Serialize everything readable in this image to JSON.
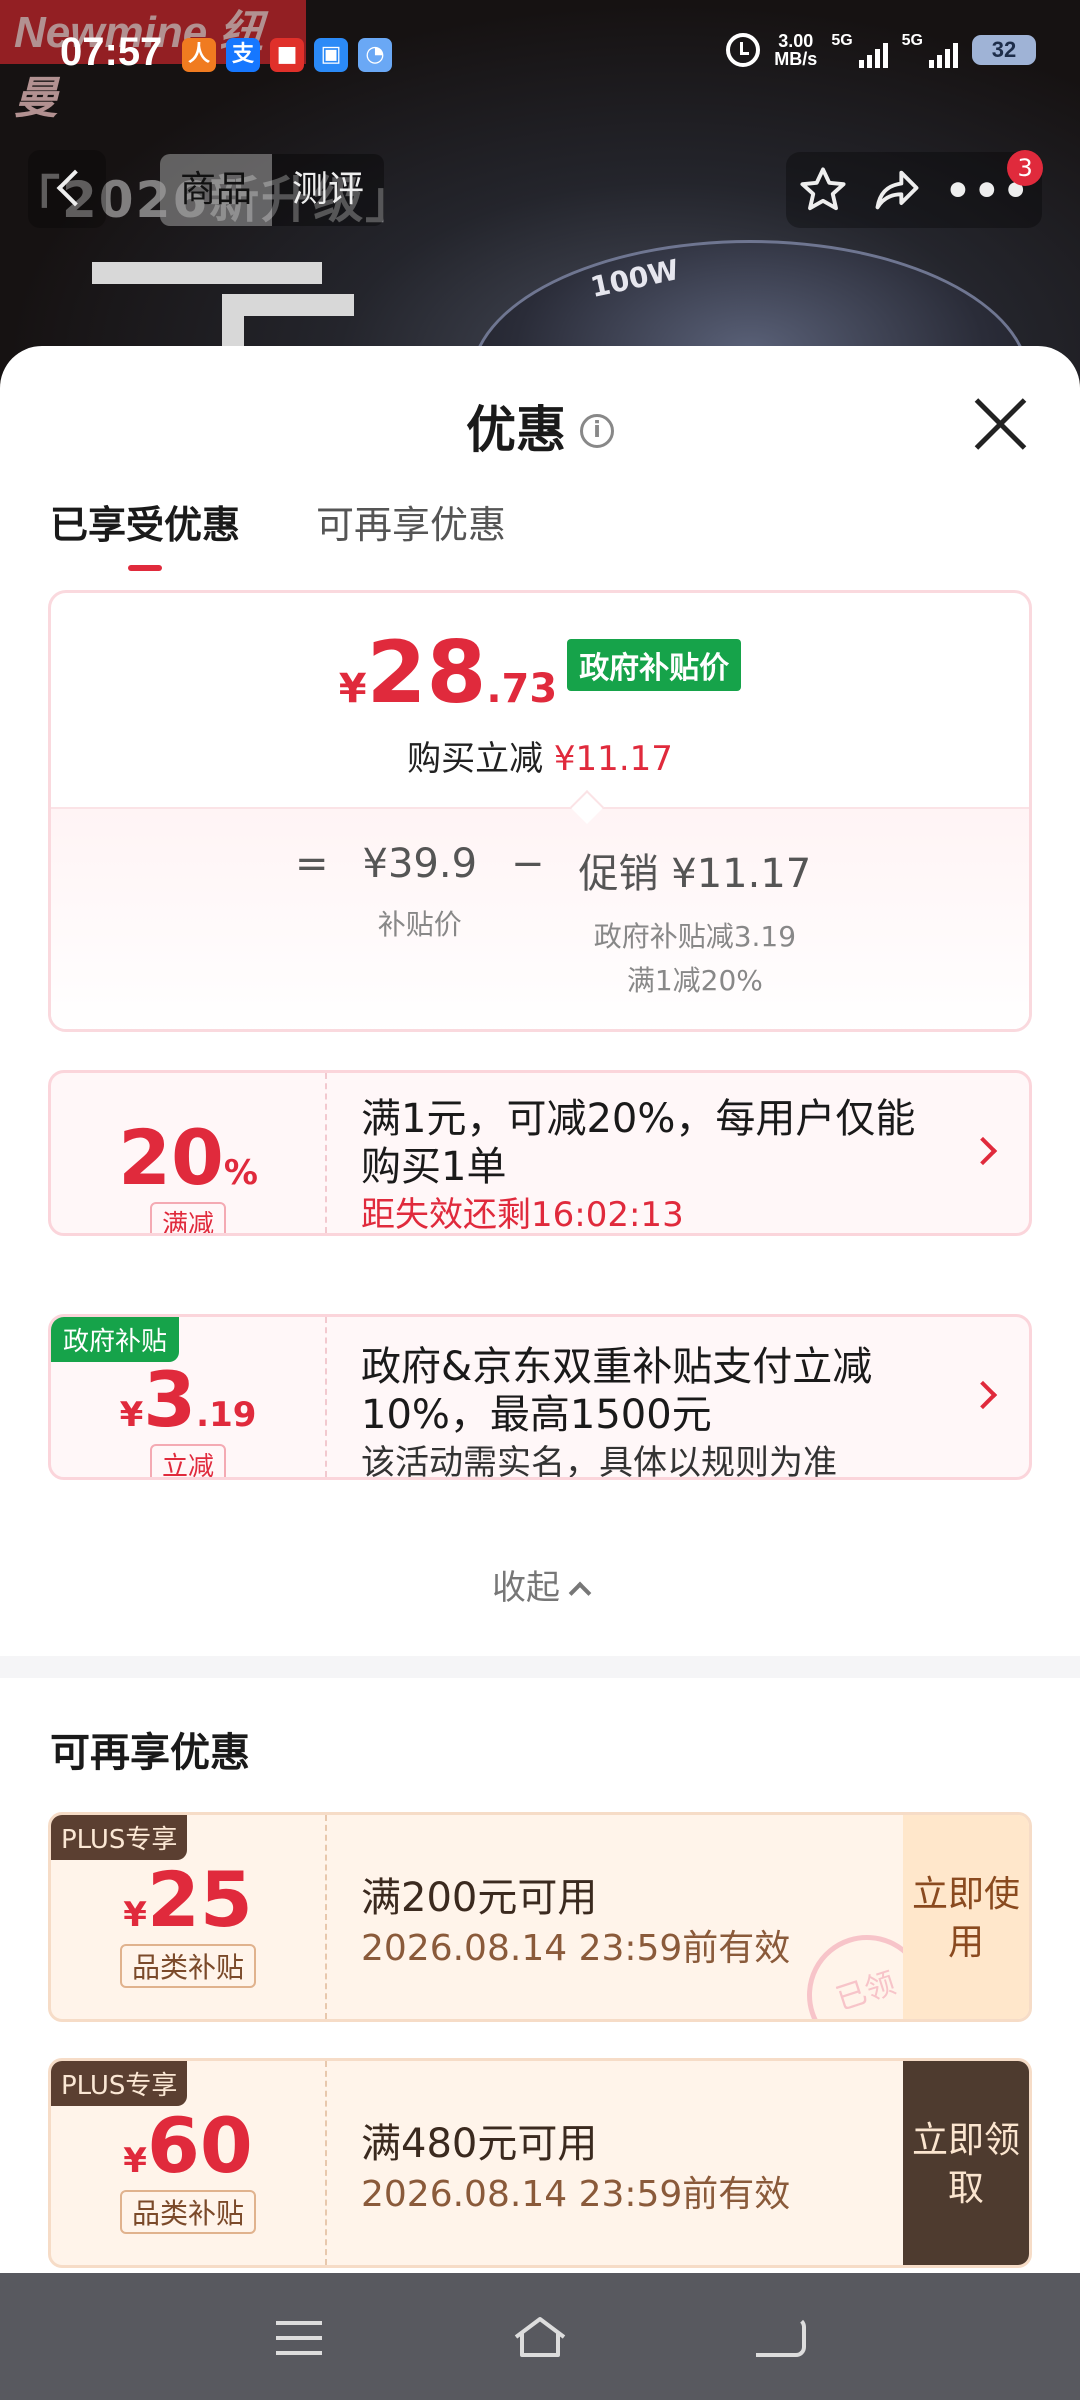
{
  "status_bar": {
    "time": "07:57",
    "speed_value": "3.00",
    "speed_unit": "MB/s",
    "net1": "5G",
    "net2": "5G",
    "battery": "32"
  },
  "backdrop": {
    "brand": "Newmine 纽曼",
    "banner_text": "「2026新升级」",
    "disc_label": "100W"
  },
  "nav": {
    "tabs": [
      "商品",
      "测评"
    ],
    "cart_badge": "3"
  },
  "sheet": {
    "title": "优惠",
    "tabs": [
      "已享受优惠",
      "可再享优惠"
    ]
  },
  "summary": {
    "currency": "¥",
    "price_int": "28",
    "price_dec": ".73",
    "gov_tag": "政府补贴价",
    "instant_label": "购买立减",
    "instant_amount": "¥11.17",
    "equals": "=",
    "base_price": "¥39.9",
    "base_label": "补贴价",
    "minus": "−",
    "promo_price": "促销 ¥11.17",
    "promo_sub1": "政府补贴减3.19",
    "promo_sub2": "满1减20%"
  },
  "promos": [
    {
      "amount": "20",
      "unit": "%",
      "kind": "满减",
      "line1": "满1元，可减20%，每用户仅能购买1单",
      "countdown": "距失效还剩16:02:13"
    },
    {
      "corner": "政府补贴",
      "currency": "¥",
      "amount": "3",
      "decimal": ".19",
      "kind": "立减",
      "line1": "政府&京东双重补贴支付立减10%，最高1500元",
      "line2": "该活动需实名，具体以规则为准"
    }
  ],
  "collapse_label": "收起",
  "more_section": {
    "title": "可再享优惠",
    "coupons": [
      {
        "plus": "PLUS专享",
        "currency": "¥",
        "amount": "25",
        "kind": "品类补贴",
        "condition": "满200元可用",
        "expiry": "2026.08.14 23:59前有效",
        "action": "立即使用",
        "stamp": "已领"
      },
      {
        "plus": "PLUS专享",
        "currency": "¥",
        "amount": "60",
        "kind": "品类补贴",
        "condition": "满480元可用",
        "expiry": "2026.08.14 23:59前有效",
        "action": "立即领取"
      }
    ]
  },
  "colors": {
    "accent_red": "#e02a3c",
    "gov_green": "#16a34a",
    "plus_brown": "#4e3b2f"
  },
  "app_icons": [
    "jd-delivery-icon",
    "alipay-icon",
    "jd-icon",
    "chat-icon",
    "finder-icon"
  ]
}
